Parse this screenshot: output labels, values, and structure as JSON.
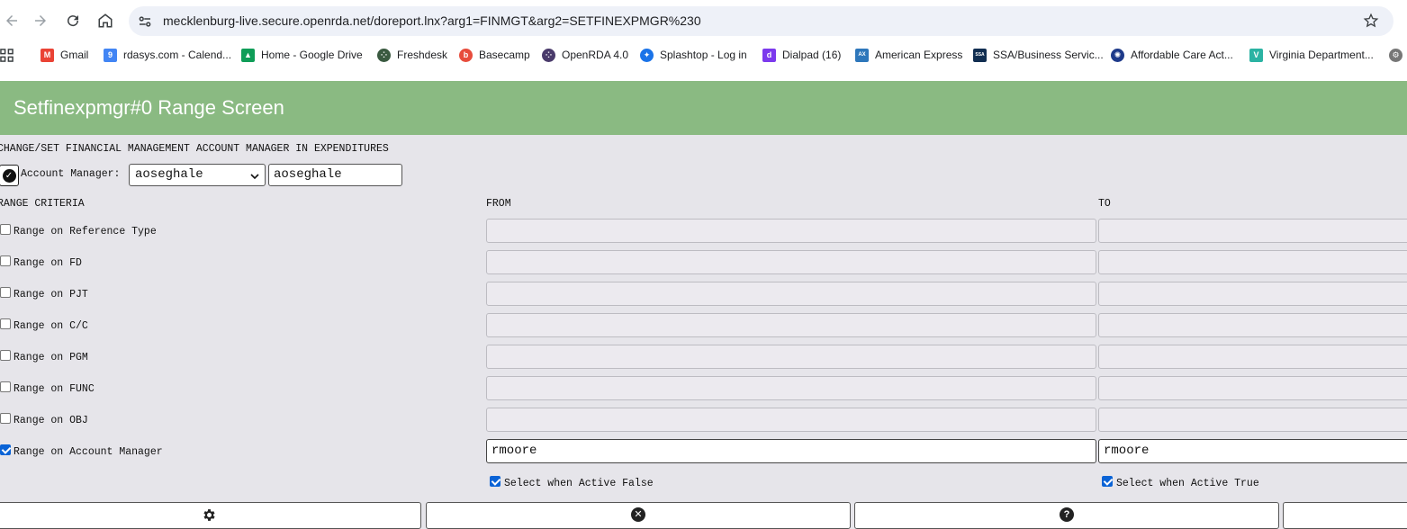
{
  "browser": {
    "url": "mecklenburg-live.secure.openrda.net/doreport.lnx?arg1=FINMGT&arg2=SETFINEXPMGR%230",
    "bookmarks": [
      {
        "label": "Gmail",
        "icon": "gmail-icon",
        "color": "#ea4335"
      },
      {
        "label": "rdasys.com - Calend...",
        "icon": "calendar-icon",
        "color": "#4285f4"
      },
      {
        "label": "Home - Google Drive",
        "icon": "google-drive-icon",
        "color": "#0f9d58"
      },
      {
        "label": "Freshdesk",
        "icon": "freshdesk-icon",
        "color": "#3a5a40"
      },
      {
        "label": "Basecamp",
        "icon": "basecamp-icon",
        "color": "#e74c3c"
      },
      {
        "label": "OpenRDA 4.0",
        "icon": "openrda-icon",
        "color": "#4a3b6b"
      },
      {
        "label": "Splashtop - Log in",
        "icon": "splashtop-icon",
        "color": "#1a73e8"
      },
      {
        "label": "Dialpad (16)",
        "icon": "dialpad-icon",
        "color": "#7c3aed"
      },
      {
        "label": "American Express",
        "icon": "amex-icon",
        "color": "#2e77bb"
      },
      {
        "label": "SSA/Business Servic...",
        "icon": "ssa-icon",
        "color": "#112e51"
      },
      {
        "label": "Affordable Care Act...",
        "icon": "aca-seal-icon",
        "color": "#1e3a8a"
      },
      {
        "label": "Virginia Department...",
        "icon": "virginia-icon",
        "color": "#2bb3a3"
      }
    ]
  },
  "page": {
    "title": "Setfinexpmgr#0 Range Screen",
    "subtitle": "CHANGE/SET FINANCIAL MANAGEMENT ACCOUNT MANAGER IN EXPENDITURES",
    "account_manager": {
      "label": "Account Manager:",
      "selected": "aoseghale",
      "value": "aoseghale"
    },
    "columns": {
      "criteria": "RANGE CRITERIA",
      "from": "FROM",
      "to": "TO"
    },
    "ranges": [
      {
        "label": "Range on Reference Type",
        "checked": false,
        "from": "",
        "to": ""
      },
      {
        "label": "Range on FD",
        "checked": false,
        "from": "",
        "to": ""
      },
      {
        "label": "Range on PJT",
        "checked": false,
        "from": "",
        "to": ""
      },
      {
        "label": "Range on C/C",
        "checked": false,
        "from": "",
        "to": ""
      },
      {
        "label": "Range on PGM",
        "checked": false,
        "from": "",
        "to": ""
      },
      {
        "label": "Range on FUNC",
        "checked": false,
        "from": "",
        "to": ""
      },
      {
        "label": "Range on OBJ",
        "checked": false,
        "from": "",
        "to": ""
      },
      {
        "label": "Range on Account Manager",
        "checked": true,
        "from": "rmoore",
        "to": "rmoore"
      }
    ],
    "select_false": {
      "label": "Select when Active False",
      "checked": true
    },
    "select_true": {
      "label": "Select when Active True",
      "checked": true
    }
  }
}
